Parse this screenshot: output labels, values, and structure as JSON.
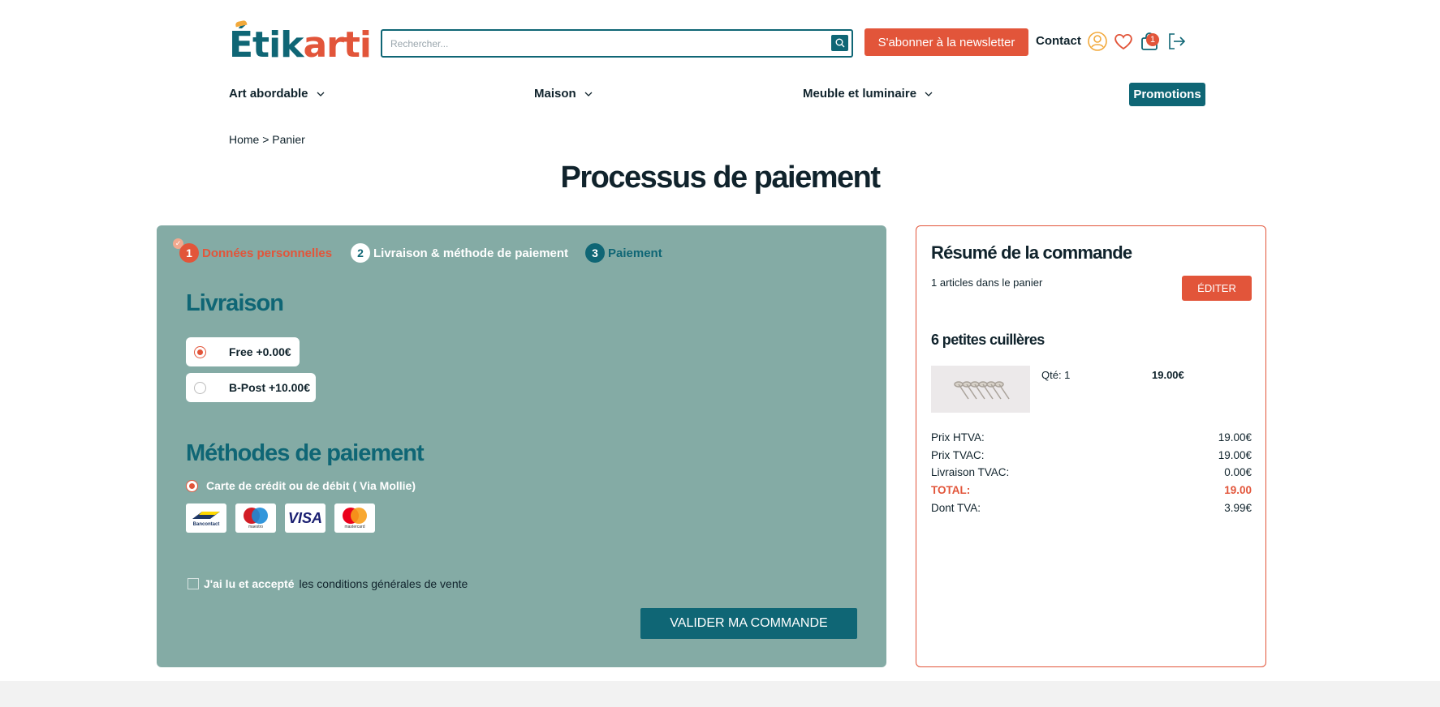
{
  "header": {
    "logo": {
      "part1": "Étik",
      "part2": "arti"
    },
    "search_placeholder": "Rechercher...",
    "newsletter_label": "S'abonner à la newsletter",
    "contact_label": "Contact",
    "cart_count": "1",
    "icons": [
      "user-icon",
      "heart-icon",
      "cart-icon",
      "logout-icon",
      "search-icon"
    ]
  },
  "nav": {
    "items": [
      {
        "label": "Art abordable"
      },
      {
        "label": "Maison"
      },
      {
        "label": "Meuble et luminaire"
      }
    ],
    "promo_label": "Promotions"
  },
  "breadcrumb": "Home > Panier",
  "page_title": "Processus de paiement",
  "steps": [
    {
      "num": "1",
      "label": "Données personnelles"
    },
    {
      "num": "2",
      "label": "Livraison & méthode de paiement"
    },
    {
      "num": "3",
      "label": "Paiement"
    }
  ],
  "shipping": {
    "title": "Livraison",
    "options": [
      {
        "label": "Free +0.00€",
        "selected": true
      },
      {
        "label": "B-Post +10.00€",
        "selected": false
      }
    ]
  },
  "payment": {
    "title": "Méthodes de paiement",
    "option_label": "Carte de crédit ou de débit ( Via Mollie)",
    "cards": [
      {
        "name": "Bancontact",
        "caption": "Bancontact"
      },
      {
        "name": "Maestro",
        "caption": "maestro"
      },
      {
        "name": "Visa",
        "caption": "VISA"
      },
      {
        "name": "Mastercard",
        "caption": "mastercard"
      }
    ]
  },
  "terms": {
    "prefix": "J'ai lu et accepté",
    "link": "les conditions générales de vente"
  },
  "submit_label": "VALIDER MA COMMANDE",
  "summary": {
    "title": "Résumé de la commande",
    "count_text": "1 articles dans le panier",
    "edit_label": "ÉDITER",
    "product": {
      "name": "6 petites cuillères",
      "qty": "Qté: 1",
      "price": "19.00€"
    },
    "totals": [
      {
        "label": "Prix HTVA:",
        "value": "19.00€"
      },
      {
        "label": "Prix TVAC:",
        "value": "19.00€"
      },
      {
        "label": "Livraison TVAC:",
        "value": "0.00€"
      },
      {
        "label": "TOTAL:",
        "value": "19.00"
      },
      {
        "label": "Dont TVA:",
        "value": "3.99€"
      }
    ]
  },
  "colors": {
    "teal": "#0f6675",
    "orange": "#e2553a",
    "panel": "#84aba5"
  }
}
